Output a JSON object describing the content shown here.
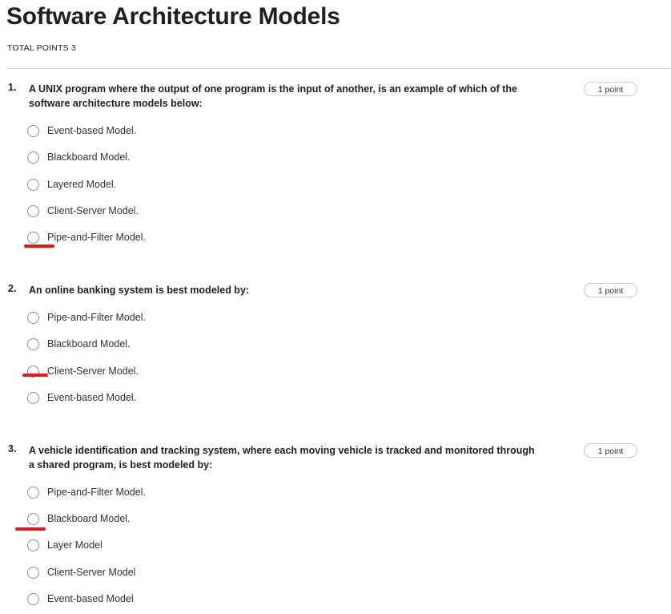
{
  "header": {
    "title": "Software Architecture Models",
    "total_points": "TOTAL POINTS 3"
  },
  "questions": [
    {
      "number": "1.",
      "text": "A UNIX program where the output of one program is the input of another, is an example of which of the software architecture models below:",
      "points": "1 point",
      "options": [
        "Event-based Model.",
        "Blackboard Model.",
        "Layered Model.",
        "Client-Server Model.",
        "Pipe-and-Filter Model."
      ]
    },
    {
      "number": "2.",
      "text": "An online banking system is best modeled by:",
      "points": "1 point",
      "options": [
        "Pipe-and-Filter Model.",
        "Blackboard Model.",
        "Client-Server Model.",
        "Event-based Model."
      ]
    },
    {
      "number": "3.",
      "text": "A vehicle identification and tracking system, where each moving vehicle is tracked and monitored through a shared program, is best modeled by:",
      "points": "1 point",
      "options": [
        "Pipe-and-Filter Model.",
        "Blackboard Model.",
        "Layer Model",
        "Client-Server Model",
        "Event-based Model"
      ]
    }
  ],
  "annotation_color": "#e11b1b"
}
